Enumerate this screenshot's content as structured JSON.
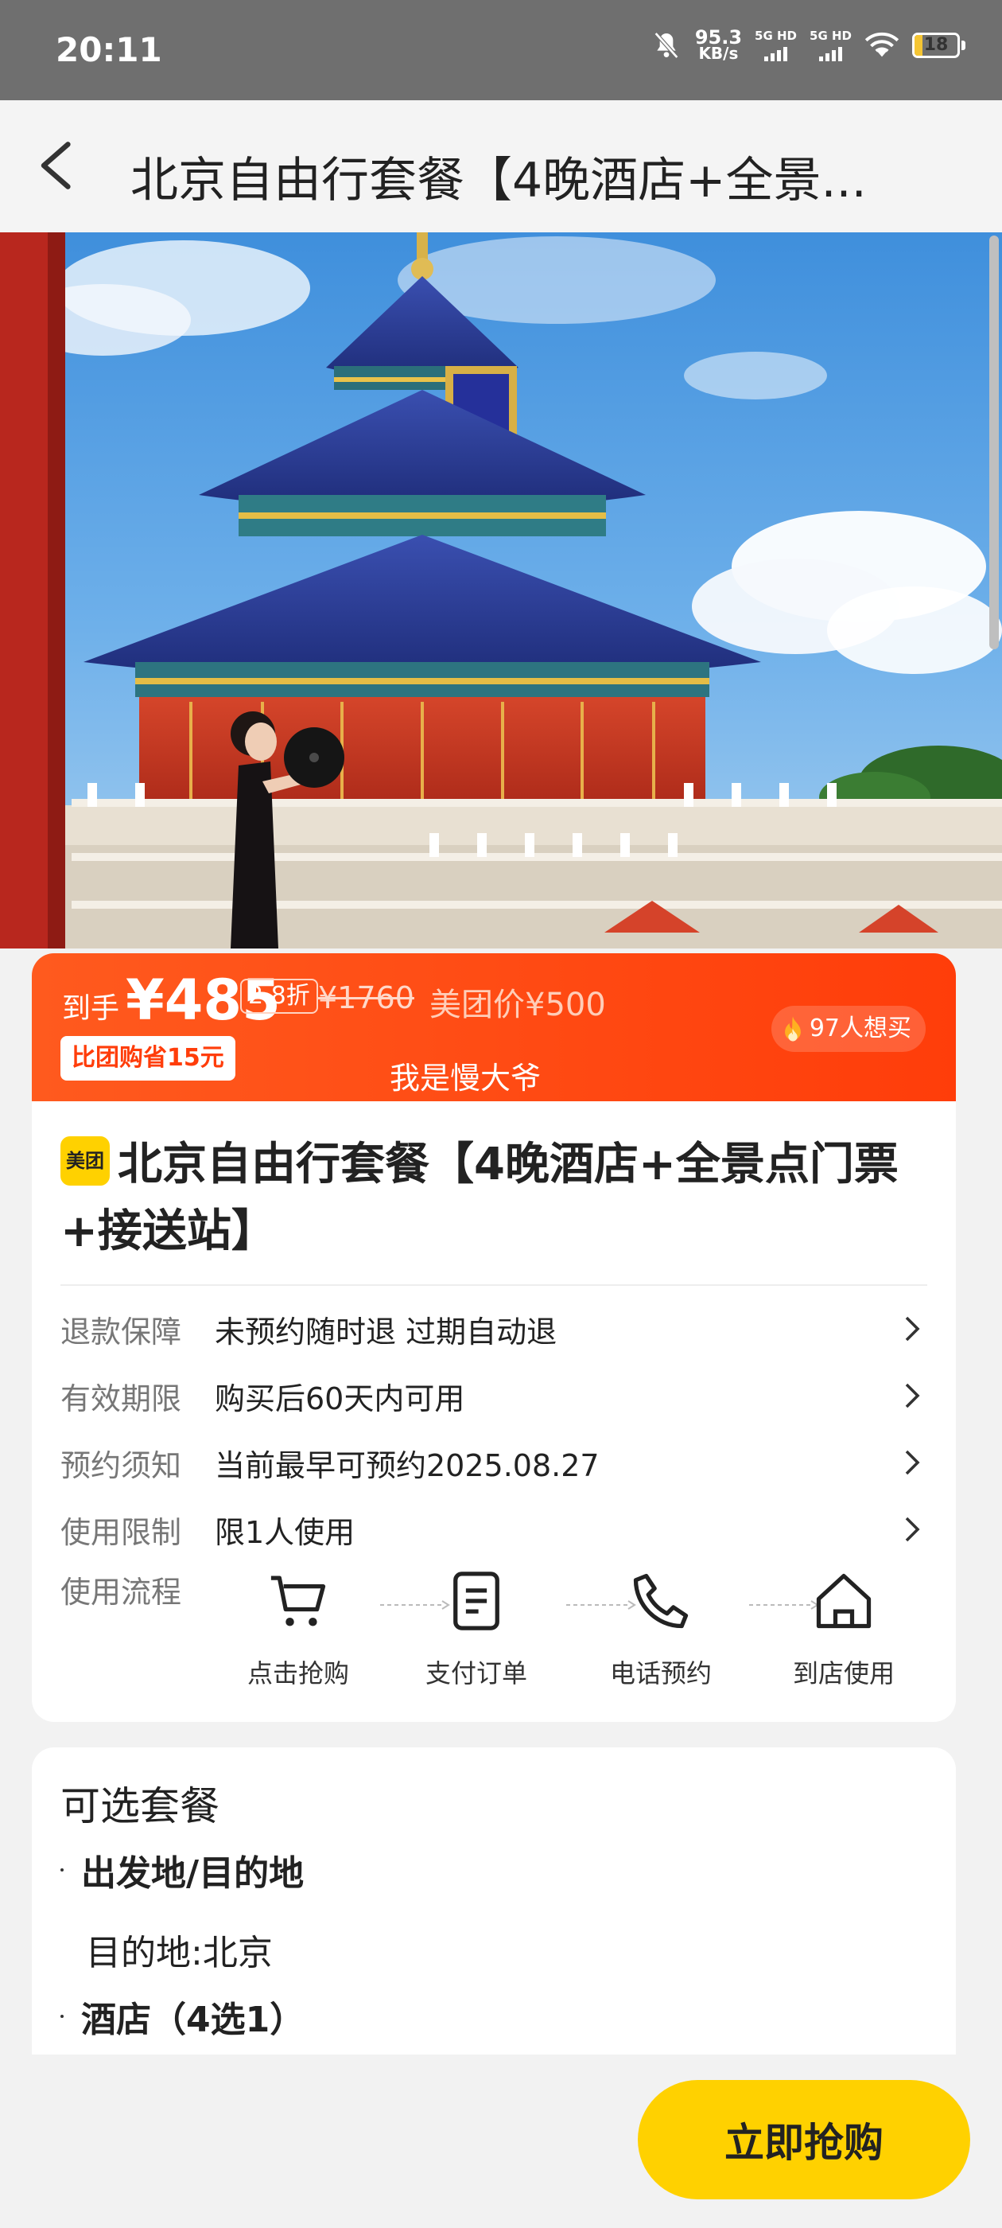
{
  "status_bar": {
    "time": "20:11",
    "net_speed_value": "95.3",
    "net_speed_unit": "KB/s",
    "sim1": "5G HD",
    "sim2": "5G HD",
    "battery_level": 18,
    "battery_text": "18",
    "icons": [
      "mute-bell-icon",
      "signal-icon",
      "wifi-icon",
      "battery-icon"
    ]
  },
  "header": {
    "title": "北京自由行套餐【4晚酒店+全景...",
    "back_icon": "back-arrow-icon"
  },
  "price": {
    "prefix": "到手",
    "amount": "¥485",
    "discount": "2.8折",
    "original": "¥1760",
    "meituan_price": "美团价¥500",
    "saving": "比团购省15元",
    "nickname": "我是慢大爷",
    "want_count": "97人想买",
    "accent_color": "#ff4a12"
  },
  "product": {
    "badge": "美团",
    "title": "北京自由行套餐【4晚酒店+全景点门票+接送站】",
    "attributes": [
      {
        "label": "退款保障",
        "value": "未预约随时退 过期自动退"
      },
      {
        "label": "有效期限",
        "value": "购买后60天内可用"
      },
      {
        "label": "预约须知",
        "value": "当前最早可预约2025.08.27"
      },
      {
        "label": "使用限制",
        "value": "限1人使用"
      }
    ],
    "flow_label": "使用流程",
    "flow_steps": [
      {
        "label": "点击抢购",
        "icon": "cart-icon"
      },
      {
        "label": "支付订单",
        "icon": "order-icon"
      },
      {
        "label": "电话预约",
        "icon": "phone-icon"
      },
      {
        "label": "到店使用",
        "icon": "home-icon"
      }
    ]
  },
  "packages": {
    "title": "可选套餐",
    "groups": [
      {
        "name": "出发地/目的地",
        "detail": "目的地:北京"
      },
      {
        "name": "酒店（4选1）"
      }
    ]
  },
  "buy_button": {
    "label": "立即抢购",
    "color": "#ffd100"
  }
}
